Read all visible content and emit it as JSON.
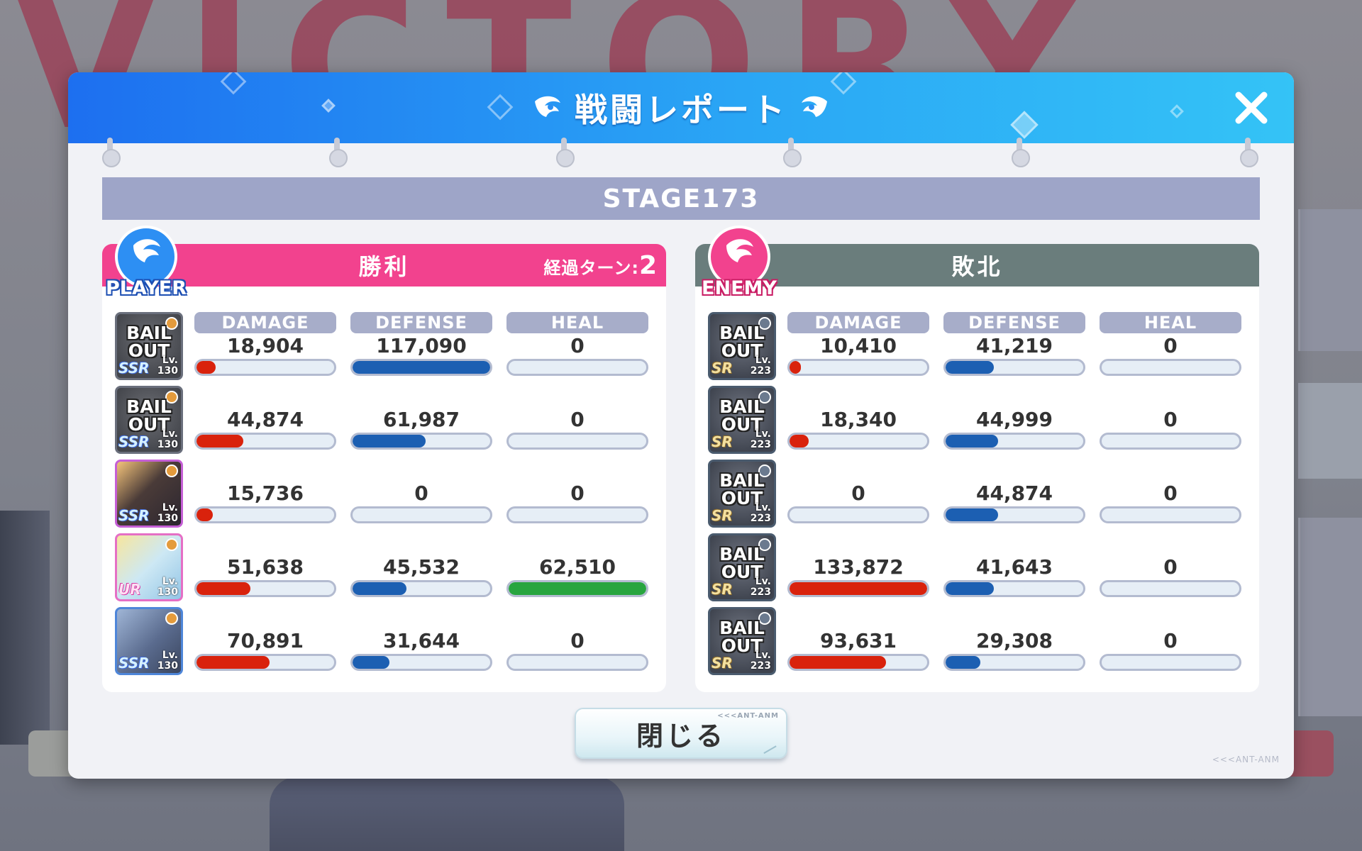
{
  "background": {
    "banner_text": "VICTORY"
  },
  "dialog": {
    "title": "戦闘レポート",
    "stage": "STAGE173",
    "close_button_label": "閉じる",
    "close_button_tag": "<<<ANT-ANM",
    "footer_logo": "<<<ANT-ANM"
  },
  "stat_labels": {
    "damage": "DAMAGE",
    "defense": "DEFENSE",
    "heal": "HEAL"
  },
  "player": {
    "badge": "PLAYER",
    "result": "勝利",
    "turns_label": "経過ターン:",
    "turns_value": "2",
    "units": [
      {
        "avatar": "bail-out",
        "avatar_text": "BAIL OUT",
        "rarity": "SSR",
        "lv": "130",
        "damage": "18,904",
        "defense": "117,090",
        "heal": "0",
        "damage_fill": 0.14,
        "defense_fill": 1.0,
        "heal_fill": 0
      },
      {
        "avatar": "bail-out",
        "avatar_text": "BAIL OUT",
        "rarity": "SSR",
        "lv": "130",
        "damage": "44,874",
        "defense": "61,987",
        "heal": "0",
        "damage_fill": 0.34,
        "defense_fill": 0.53,
        "heal_fill": 0
      },
      {
        "avatar": "character",
        "avatar_text": "",
        "rarity": "SSR",
        "lv": "130",
        "damage": "15,736",
        "defense": "0",
        "heal": "0",
        "damage_fill": 0.12,
        "defense_fill": 0,
        "heal_fill": 0
      },
      {
        "avatar": "character",
        "avatar_text": "",
        "rarity": "UR",
        "lv": "130",
        "damage": "51,638",
        "defense": "45,532",
        "heal": "62,510",
        "damage_fill": 0.39,
        "defense_fill": 0.39,
        "heal_fill": 1.0
      },
      {
        "avatar": "character",
        "avatar_text": "",
        "rarity": "SSR",
        "lv": "130",
        "damage": "70,891",
        "defense": "31,644",
        "heal": "0",
        "damage_fill": 0.53,
        "defense_fill": 0.27,
        "heal_fill": 0
      }
    ]
  },
  "enemy": {
    "badge": "ENEMY",
    "result": "敗北",
    "units": [
      {
        "avatar_text": "BAIL OUT",
        "rarity": "SR",
        "lv": "223",
        "damage": "10,410",
        "defense": "41,219",
        "heal": "0",
        "damage_fill": 0.08,
        "defense_fill": 0.35,
        "heal_fill": 0
      },
      {
        "avatar_text": "BAIL OUT",
        "rarity": "SR",
        "lv": "223",
        "damage": "18,340",
        "defense": "44,999",
        "heal": "0",
        "damage_fill": 0.14,
        "defense_fill": 0.38,
        "heal_fill": 0
      },
      {
        "avatar_text": "BAIL OUT",
        "rarity": "SR",
        "lv": "223",
        "damage": "0",
        "defense": "44,874",
        "heal": "0",
        "damage_fill": 0,
        "defense_fill": 0.38,
        "heal_fill": 0
      },
      {
        "avatar_text": "BAIL OUT",
        "rarity": "SR",
        "lv": "223",
        "damage": "133,872",
        "defense": "41,643",
        "heal": "0",
        "damage_fill": 1.0,
        "defense_fill": 0.35,
        "heal_fill": 0
      },
      {
        "avatar_text": "BAIL OUT",
        "rarity": "SR",
        "lv": "223",
        "damage": "93,631",
        "defense": "29,308",
        "heal": "0",
        "damage_fill": 0.7,
        "defense_fill": 0.25,
        "heal_fill": 0
      }
    ]
  },
  "colors": {
    "header_gradient_start": "#1d6ff0",
    "header_gradient_end": "#34c3f6",
    "player_header": "#f2428e",
    "enemy_header": "#6a7d7c",
    "damage_bar": "#d9220c",
    "defense_bar": "#1c5fb2",
    "heal_bar": "#28a53f",
    "stage_bar": "#9ea5c8"
  }
}
